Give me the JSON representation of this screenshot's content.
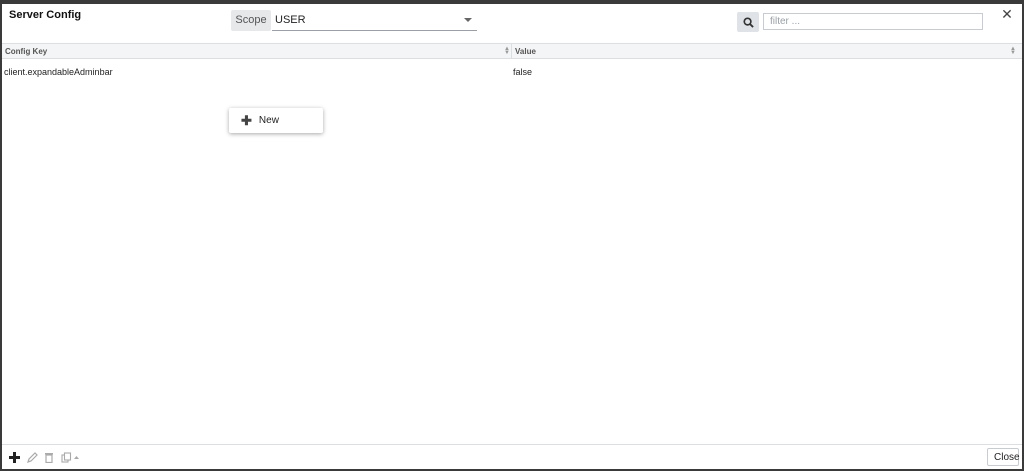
{
  "dialog": {
    "title": "Server Config",
    "close_icon": "close-icon"
  },
  "scope": {
    "label": "Scope",
    "value": "USER"
  },
  "search": {
    "icon": "search-icon",
    "placeholder": "filter ..."
  },
  "grid": {
    "columns": [
      "Config Key",
      "Value"
    ],
    "rows": [
      {
        "key": "client.expandableAdminbar",
        "value": "false"
      }
    ]
  },
  "context_menu": {
    "items": [
      {
        "label": "New",
        "icon": "plus-icon"
      }
    ]
  },
  "footer": {
    "tools": [
      "add-icon",
      "edit-icon",
      "delete-icon",
      "copy-dropdown-icon"
    ],
    "close_label": "Close"
  }
}
